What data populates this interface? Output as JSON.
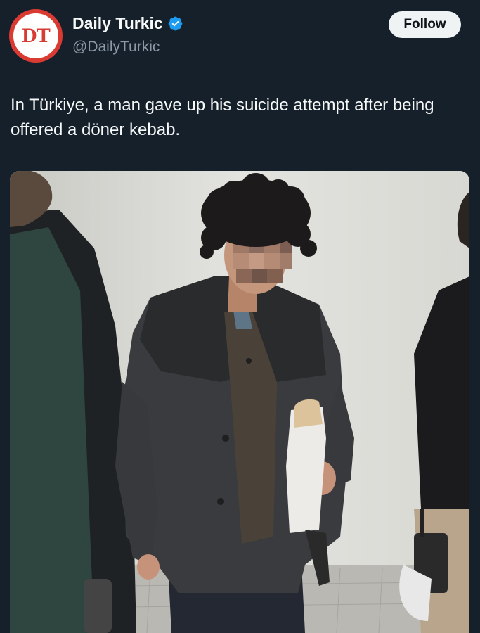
{
  "account": {
    "avatar_text": "DT",
    "display_name": "Daily Turkic",
    "handle": "@DailyTurkic",
    "verified_icon": "verified-badge-icon"
  },
  "actions": {
    "follow_label": "Follow"
  },
  "tweet": {
    "text": "In Türkiye, a man gave up his suicide attempt after being offered a döner kebab."
  },
  "media": {
    "type": "photo"
  },
  "colors": {
    "background": "#15202b",
    "avatar_red": "#d93a32",
    "verified_blue": "#1d9bf0",
    "follow_bg": "#eff3f4"
  }
}
